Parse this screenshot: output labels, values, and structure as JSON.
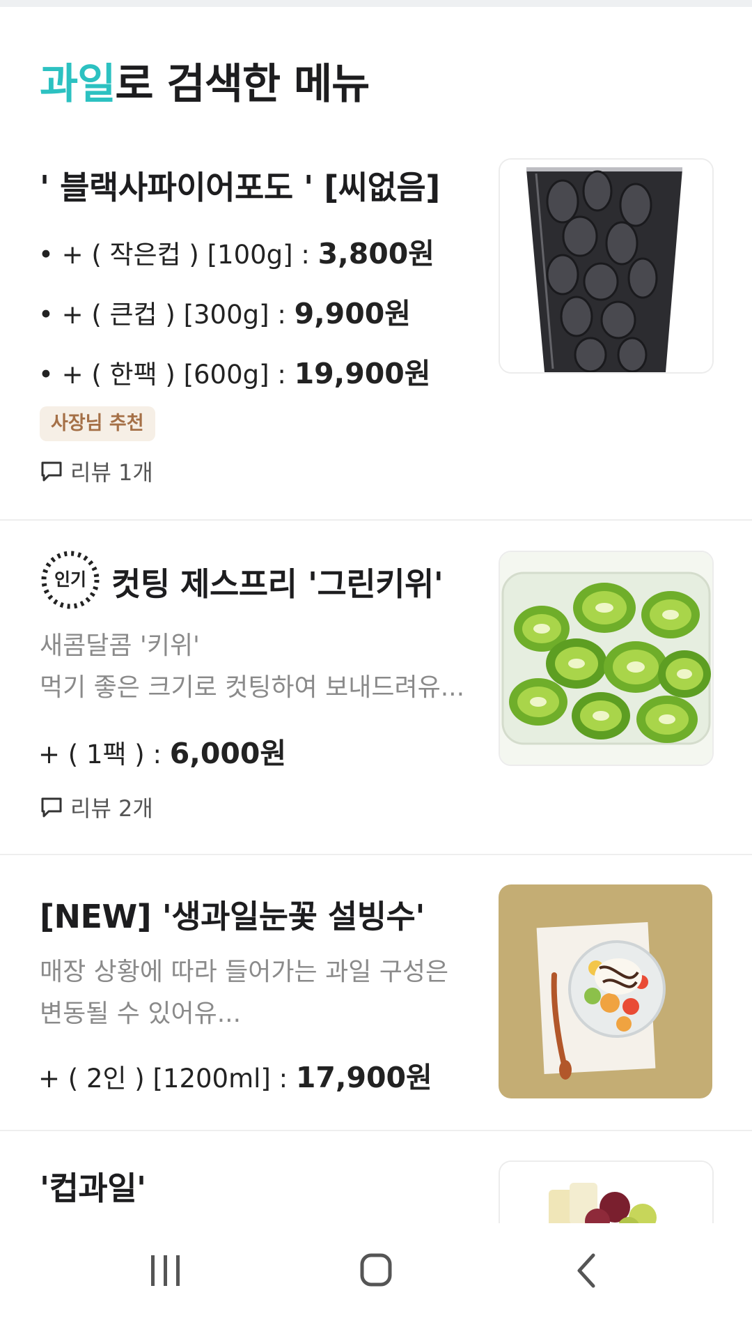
{
  "header": {
    "keyword": "과일",
    "title_rest": "로 검색한 메뉴"
  },
  "menu_items": [
    {
      "title": "' 블랙사파이어포도 ' [씨없음]",
      "options": [
        {
          "label": "• + ( 작은컵 ) [100g] : ",
          "price": "3,800원"
        },
        {
          "label": "• + ( 큰컵 ) [300g] : ",
          "price": "9,900원"
        },
        {
          "label": "• + ( 한팩 ) [600g] : ",
          "price": "19,900원"
        }
      ],
      "badge": "사장님 추천",
      "review": "리뷰 1개",
      "image": "black-grape-cup"
    },
    {
      "popular_label": "인기",
      "title": "컷팅 제스프리 '그린키위'",
      "description": [
        "새콤달콤 '키위'",
        "먹기 좋은 크기로 컷팅하여 보내드려유..."
      ],
      "options": [
        {
          "label": "+ ( 1팩 ) : ",
          "price": "6,000원"
        }
      ],
      "review": "리뷰 2개",
      "image": "green-kiwi-pack"
    },
    {
      "title": "[NEW] '생과일눈꽃 설빙수'",
      "description": [
        "매장 상황에 따라 들어가는 과일 구성은",
        "변동될 수 있어유..."
      ],
      "options": [
        {
          "label": "+ ( 2인 ) [1200ml] : ",
          "price": "17,900원"
        }
      ],
      "image": "fruit-bingsu"
    },
    {
      "title": "'컵과일'",
      "image": "cup-fruit"
    }
  ],
  "navigation": [
    "recent-apps-icon",
    "home-icon",
    "back-icon"
  ],
  "colors": {
    "accent": "#2cc1c1",
    "badge_bg": "#f6efe6",
    "badge_text": "#a57047"
  }
}
